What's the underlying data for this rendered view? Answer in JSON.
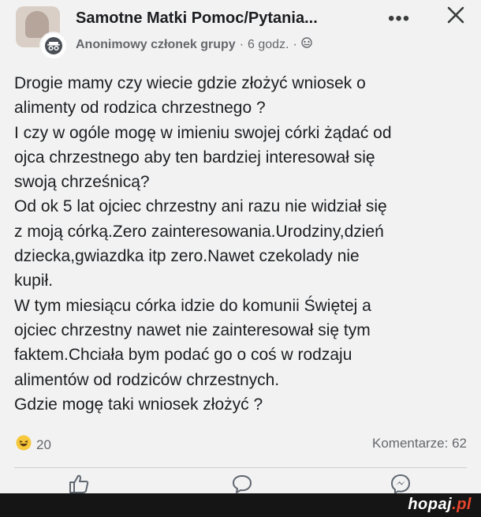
{
  "header": {
    "group_name": "Samotne Matki Pomoc/Pytania...",
    "author": "Anonimowy członek grupy",
    "separator": "·",
    "time": "6 godz.",
    "more_icon": "ellipsis-icon",
    "close_icon": "close-icon"
  },
  "post": {
    "lines": [
      "Drogie mamy czy wiecie gdzie złożyć wniosek o",
      "alimenty od rodzica chrzestnego ?",
      "I czy w ogóle mogę w imieniu swojej córki żądać od",
      "ojca chrzestnego  aby ten bardziej interesował się",
      "swoją chrześnicą?",
      "Od ok 5 lat ojciec chrzestny ani razu nie widział się",
      "z moją córką.Zero zainteresowania.Urodziny,dzień",
      "dziecka,gwiazdka itp zero.Nawet czekolady nie",
      "kupił.",
      "W tym miesiącu córka idzie do komunii Świętej a",
      "ojciec chrzestny nawet nie zainteresował się tym",
      "faktem.Chciała bym podać go o coś w rodzaju",
      "alimentów od rodziców chrzestnych.",
      "Gdzie mogę taki wniosek złożyć ?"
    ]
  },
  "footer": {
    "reaction_icon": "haha-emoji-icon",
    "reaction_count": "20",
    "comments": "Komentarze: 62"
  },
  "actions": [
    "like-icon",
    "comment-icon",
    "messenger-icon"
  ],
  "watermark": {
    "name": "hopaj",
    "tld": ".pl"
  },
  "colors": {
    "text": "#1c1e21",
    "muted": "#65676b",
    "background": "#f2f2f2",
    "watermark_dot": "#e8452c"
  }
}
